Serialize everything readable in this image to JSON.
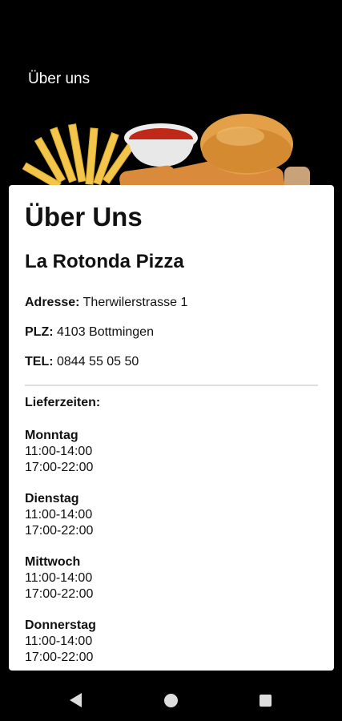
{
  "app_bar": {
    "title": "Über uns"
  },
  "about": {
    "title": "Über Uns",
    "restaurant_name": "La Rotonda Pizza",
    "address_label": "Adresse:",
    "address_value": "Therwilerstrasse 1",
    "plz_label": "PLZ:",
    "plz_value": "4103 Bottmingen",
    "tel_label": "TEL:",
    "tel_value": "0844 55 05 50",
    "delivery_label": "Lieferzeiten:",
    "days": [
      {
        "name": "Monntag",
        "slot1": "11:00-14:00",
        "slot2": "17:00-22:00"
      },
      {
        "name": "Dienstag",
        "slot1": "11:00-14:00",
        "slot2": "17:00-22:00"
      },
      {
        "name": "Mittwoch",
        "slot1": "11:00-14:00",
        "slot2": "17:00-22:00"
      },
      {
        "name": "Donnerstag",
        "slot1": "11:00-14:00",
        "slot2": "17:00-22:00"
      }
    ]
  },
  "icons": {
    "back": "back-triangle-icon",
    "home": "home-circle-icon",
    "recent": "recent-square-icon"
  },
  "colors": {
    "background": "#000000",
    "card": "#ffffff",
    "sauce": "#c0281a",
    "fries": "#f3c64a",
    "bun": "#e3a048"
  }
}
